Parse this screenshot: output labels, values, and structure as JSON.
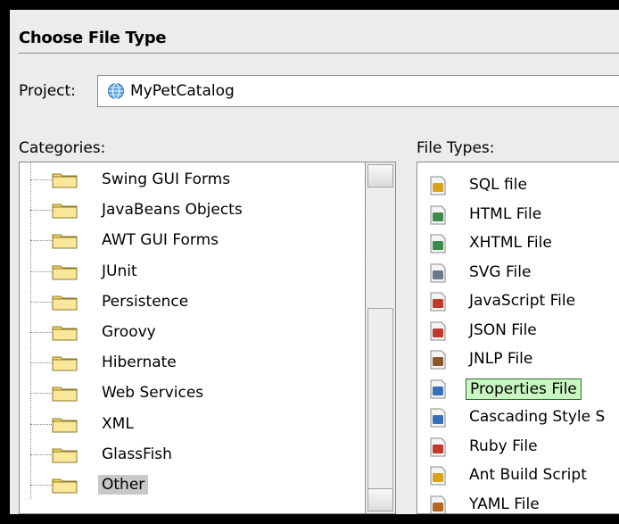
{
  "dialog": {
    "title": "Choose File Type"
  },
  "project": {
    "label": "Project:",
    "value": "MyPetCatalog"
  },
  "categories": {
    "label": "Categories:",
    "items": [
      {
        "label": "Swing GUI Forms"
      },
      {
        "label": "JavaBeans Objects"
      },
      {
        "label": "AWT GUI Forms"
      },
      {
        "label": "JUnit"
      },
      {
        "label": "Persistence"
      },
      {
        "label": "Groovy"
      },
      {
        "label": "Hibernate"
      },
      {
        "label": "Web Services"
      },
      {
        "label": "XML"
      },
      {
        "label": "GlassFish"
      },
      {
        "label": "Other",
        "selected": true
      }
    ]
  },
  "file_types": {
    "label": "File Types:",
    "items": [
      {
        "label": "SQL file",
        "icon": "sql-file-icon",
        "color": "#d9a21b"
      },
      {
        "label": "HTML File",
        "icon": "html-file-icon",
        "color": "#3a8a4a"
      },
      {
        "label": "XHTML File",
        "icon": "xhtml-file-icon",
        "color": "#3a8a4a"
      },
      {
        "label": "SVG File",
        "icon": "svg-file-icon",
        "color": "#6b7a8a"
      },
      {
        "label": "JavaScript File",
        "icon": "javascript-file-icon",
        "color": "#c0392b"
      },
      {
        "label": "JSON File",
        "icon": "json-file-icon",
        "color": "#c0392b"
      },
      {
        "label": "JNLP File",
        "icon": "jnlp-file-icon",
        "color": "#8a5a2a"
      },
      {
        "label": "Properties File",
        "icon": "properties-file-icon",
        "color": "#3b6fb5",
        "selected": true
      },
      {
        "label": "Cascading Style S",
        "icon": "css-file-icon",
        "color": "#3b6fb5"
      },
      {
        "label": "Ruby File",
        "icon": "ruby-file-icon",
        "color": "#c0392b"
      },
      {
        "label": "Ant Build Script",
        "icon": "ant-build-icon",
        "color": "#d9a21b"
      },
      {
        "label": "YAML File",
        "icon": "yaml-file-icon",
        "color": "#b5651d"
      }
    ]
  },
  "colors": {
    "selection_category": "#c8c8c8",
    "selection_filetype": "#c9f7c2",
    "folder": "#f5d565"
  }
}
